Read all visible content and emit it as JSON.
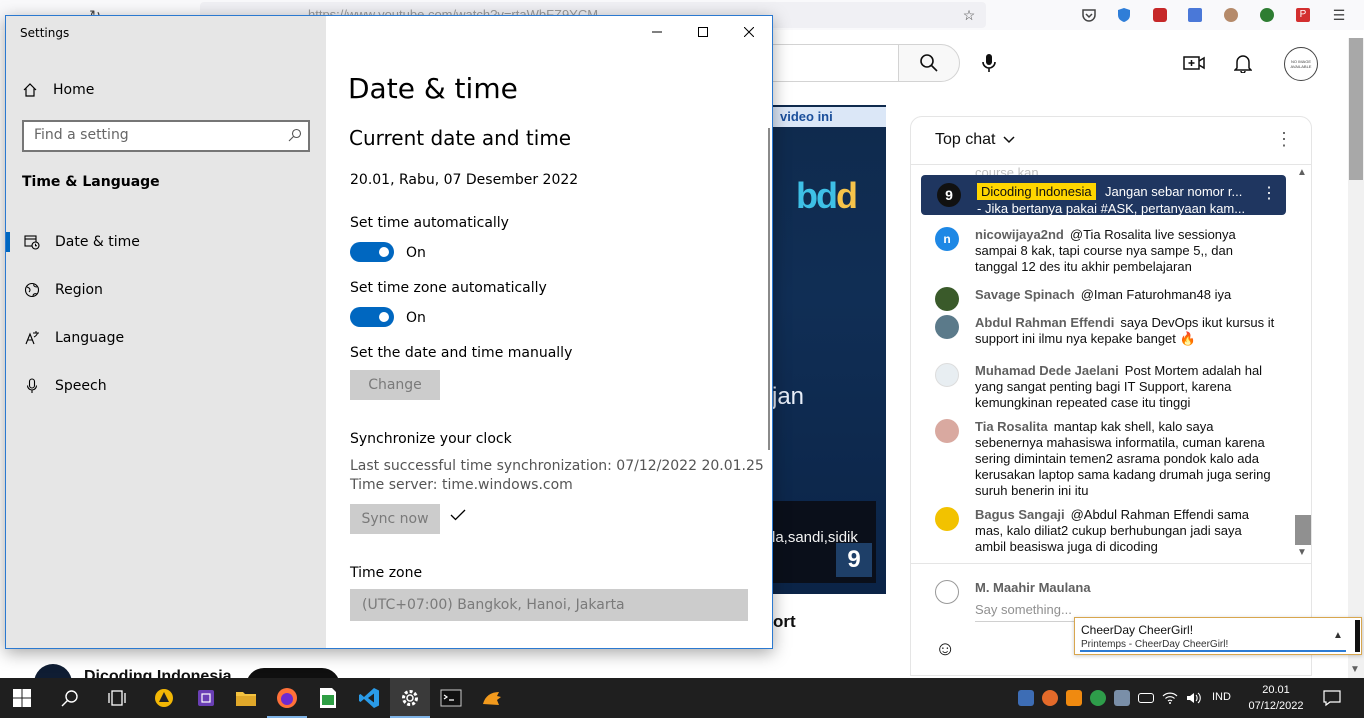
{
  "browser": {
    "url": "https://www.youtube.com/watch?v=rtaWbFZ9YCM",
    "search_icon": "search-icon",
    "mic_icon": "mic-icon",
    "create_icon": "create-video-icon",
    "bell_icon": "bell-icon",
    "avatar_text": "NO IMAGE AVAILABLE"
  },
  "video": {
    "ad_label": "video ini",
    "logo_a": "bd",
    "logo_b": "d",
    "overlay_text": "jan",
    "subtitle": "la,sandi,sidik",
    "corner_badge": "9",
    "below_title_fragment": "ort",
    "channel_name": "Dicoding Indonesia"
  },
  "chat": {
    "title": "Top chat",
    "faded_text": "course kan",
    "pinned": {
      "avatar": "9",
      "author": "Dicoding Indonesia",
      "message": "Jangan sebar nomor r...",
      "line2": "- Jika bertanya pakai #ASK, pertanyaan kam..."
    },
    "messages": [
      {
        "author": "nicowijaya2nd",
        "text": "@Tia Rosalita live sessionya sampai 8 kak, tapi course nya sampe 5,, dan tanggal 12 des itu akhir pembelajaran",
        "avatar_color": "#1e88e5",
        "avatar_letter": "n"
      },
      {
        "author": "Savage Spinach",
        "text": "@Iman Faturohman48 iya",
        "avatar_color": "#3a5a2a",
        "avatar_letter": ""
      },
      {
        "author": "Abdul Rahman Effendi",
        "text": "saya DevOps ikut kursus it support ini ilmu nya kepake banget 🔥",
        "avatar_color": "#5b7a8a",
        "avatar_letter": ""
      },
      {
        "author": "Muhamad Dede Jaelani",
        "text": "Post Mortem adalah hal yang sangat penting bagi IT Support, karena kemungkinan repeated case itu tinggi",
        "avatar_color": "#e8eef2",
        "avatar_letter": ""
      },
      {
        "author": "Tia Rosalita",
        "text": "mantap kak shell, kalo saya sebenernya mahasiswa informatila, cuman karena sering dimintain temen2 asrama pondok kalo ada kerusakan laptop sama kadang drumah juga sering suruh benerin ini itu",
        "avatar_color": "#d9a9a0",
        "avatar_letter": ""
      },
      {
        "author": "Bagus Sangaji",
        "text": "@Abdul Rahman Effendi sama mas, kalo diliat2 cukup berhubungan jadi saya ambil beasiswa juga di dicoding",
        "avatar_color": "#f2c200",
        "avatar_letter": ""
      }
    ],
    "input_user": "M. Maahir Maulana",
    "input_placeholder": "Say something...",
    "emoji_icon": "emoji-icon"
  },
  "toast": {
    "title": "CheerDay CheerGirl!",
    "subtitle": "Printemps - CheerDay CheerGirl!"
  },
  "settings": {
    "window_title": "Settings",
    "home_label": "Home",
    "search_placeholder": "Find a setting",
    "section_label": "Time & Language",
    "nav": [
      {
        "label": "Date & time",
        "icon": "clock-calendar-icon"
      },
      {
        "label": "Region",
        "icon": "globe-icon"
      },
      {
        "label": "Language",
        "icon": "language-icon"
      },
      {
        "label": "Speech",
        "icon": "microphone-icon"
      }
    ],
    "page_title": "Date & time",
    "current_heading": "Current date and time",
    "current_value": "20.01, Rabu, 07 Desember 2022",
    "set_time_auto_label": "Set time automatically",
    "set_time_auto_state": "On",
    "set_tz_auto_label": "Set time zone automatically",
    "set_tz_auto_state": "On",
    "manual_label": "Set the date and time manually",
    "change_button": "Change",
    "sync_heading": "Synchronize your clock",
    "sync_last": "Last successful time synchronization: 07/12/2022 20.01.25",
    "sync_server": "Time server: time.windows.com",
    "sync_button": "Sync now",
    "timezone_label": "Time zone",
    "timezone_value": "(UTC+07:00) Bangkok, Hanoi, Jakarta"
  },
  "taskbar": {
    "language": "IND",
    "time": "20.01",
    "date": "07/12/2022"
  }
}
